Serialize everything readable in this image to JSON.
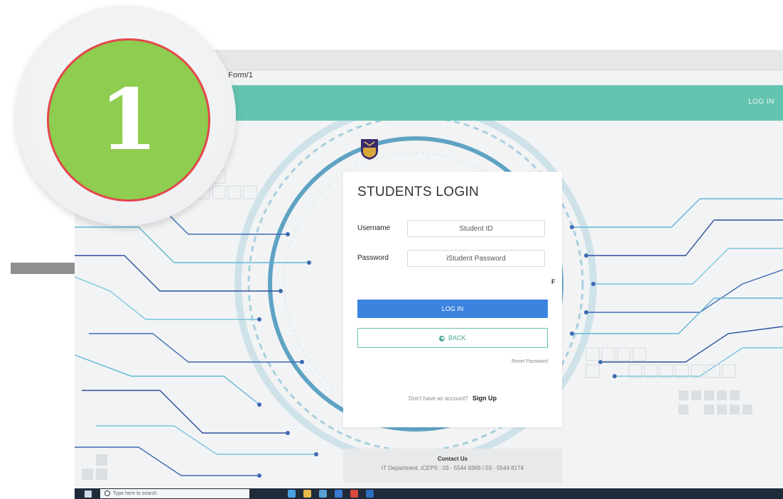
{
  "browser": {
    "address_fragment": "nForm/1"
  },
  "header": {
    "login_link": "LOG IN"
  },
  "login": {
    "title": "STUDENTS LOGIN",
    "username_label": "Username",
    "username_placeholder": "Student ID",
    "password_label": "Password",
    "password_placeholder": "iStudent Password",
    "fp_text": "F",
    "login_button": "LOG IN",
    "back_button": "BACK",
    "reset_password": "Reset Password",
    "no_account_text": "Don't have an account?",
    "signup_link": "Sign Up"
  },
  "contact": {
    "title": "Contact Us",
    "info": "IT Department, iCEPS : 03 - 5544 8369 / 03 - 5544 8174"
  },
  "taskbar": {
    "search_text": "Type here to search"
  },
  "step_badge": {
    "number": "1"
  },
  "colors": {
    "teal": "#63c4b0",
    "blue_button": "#3b83df",
    "badge_green": "#8ecd4f",
    "badge_border": "#e3474b"
  }
}
